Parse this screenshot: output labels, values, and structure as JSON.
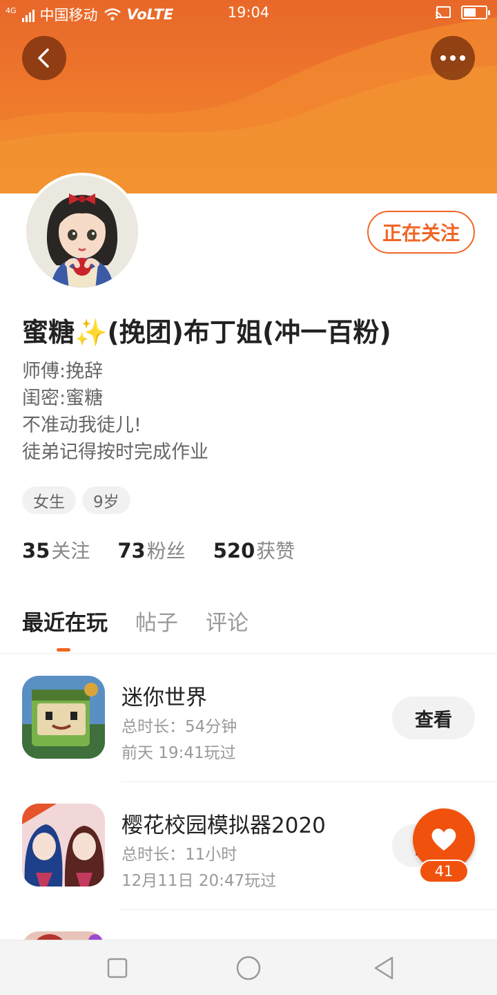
{
  "status_bar": {
    "network": "4G",
    "carrier": "中国移动",
    "volte": "VoLTE",
    "time": "19:04",
    "battery_level": 0.55
  },
  "header": {
    "back_icon": "chevron-left-icon",
    "more_icon": "more-horizontal-icon"
  },
  "profile": {
    "follow_label": "正在关注",
    "nickname": "蜜糖✨(挽团)布丁姐(冲一百粉)",
    "bio": [
      "师傅:挽辞",
      "闺密:蜜糖",
      "不准动我徒儿!",
      "徒弟记得按时完成作业"
    ],
    "tags": [
      "女生",
      "9岁"
    ],
    "stats": [
      {
        "count": "35",
        "label": "关注"
      },
      {
        "count": "73",
        "label": "粉丝"
      },
      {
        "count": "520",
        "label": "获赞"
      }
    ]
  },
  "tabs": [
    "最近在玩",
    "帖子",
    "评论"
  ],
  "games": [
    {
      "name": "迷你世界",
      "duration": "总时长：54分钟",
      "last_played": "前天 19:41玩过",
      "button": "查看"
    },
    {
      "name": "樱花校园模拟器2020",
      "duration": "总时长：11小时",
      "last_played": "12月11日 20:47玩过",
      "button": "查看"
    }
  ],
  "like": {
    "count": "41",
    "icon": "heart-icon"
  },
  "colors": {
    "accent": "#f06525",
    "banner": "#ec6f2c"
  }
}
